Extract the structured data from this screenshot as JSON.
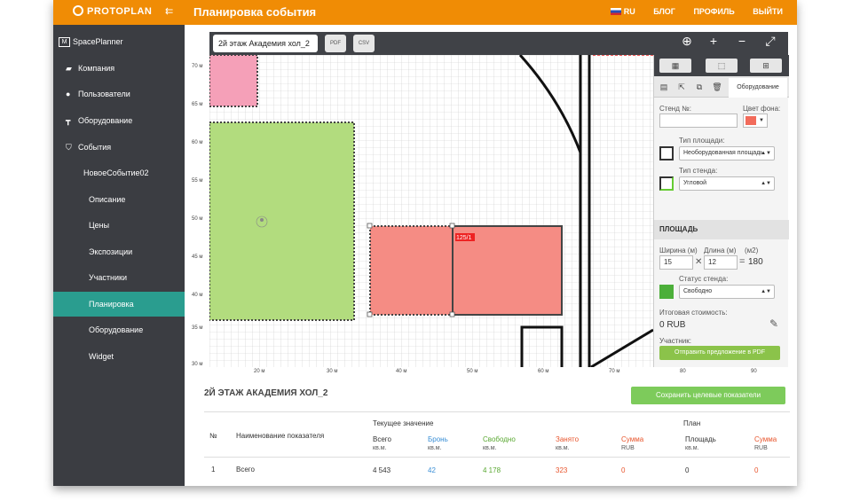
{
  "app": {
    "logo": "PROTOPLAN",
    "collapse_icon": "collapse-icon",
    "page_title": "Планировка события"
  },
  "topnav": {
    "lang": "RU",
    "blog": "БЛОГ",
    "profile": "ПРОФИЛЬ",
    "logout": "ВЫЙТИ"
  },
  "sidebar": {
    "brand": "SpacePlanner",
    "items": [
      {
        "label": "Компания",
        "icon": "briefcase-icon"
      },
      {
        "label": "Пользователи",
        "icon": "user-icon"
      },
      {
        "label": "Оборудование",
        "icon": "table-icon"
      },
      {
        "label": "События",
        "icon": "shield-icon"
      }
    ],
    "event_name": "НовоеСобытие02",
    "sub_items": [
      "Описание",
      "Цены",
      "Экспозиции",
      "Участники",
      "Планировка",
      "Оборудование",
      "Widget"
    ],
    "active": "Планировка"
  },
  "toolbar": {
    "floor_select": "2й этаж Академия хол_2",
    "btn_pdf": "PDF",
    "btn_csv": "CSV"
  },
  "axes": {
    "y_ticks": [
      "70 м",
      "65 м",
      "60 м",
      "55 м",
      "50 м",
      "45 м",
      "40 м",
      "35 м",
      "30 м"
    ],
    "x_ticks": [
      "20 м",
      "30 м",
      "40 м",
      "50 м",
      "60 м",
      "70 м",
      "80 м",
      "90 м"
    ]
  },
  "canvas": {
    "stand_label": "125/1"
  },
  "panel": {
    "tab_equipment": "Оборудование",
    "stand_no_label": "Стенд №:",
    "stand_no_value": "",
    "bg_color_label": "Цвет фона:",
    "bg_color": "#f26b5b",
    "area_type_label": "Тип площади:",
    "area_type_value": "Необорудованная площадь",
    "stand_type_label": "Тип стенда:",
    "stand_type_value": "Угловой",
    "section_title": "ПЛОЩАДЬ",
    "width_label": "Ширина (м)",
    "length_label": "Длина (м)",
    "m2_label": "(м2)",
    "width_value": "15",
    "length_value": "12",
    "times": "✕",
    "equals": "=",
    "area_value": "180",
    "status_label": "Статус стенда:",
    "status_value": "Свободно",
    "status_color": "#4caf3a",
    "cost_label": "Итоговая стоимость:",
    "cost_value": "0 RUB",
    "participant_label": "Участник:",
    "pdf_button": "Отправить предложение в PDF"
  },
  "bottom": {
    "floor_title": "2Й ЭТАЖ АКАДЕМИЯ ХОЛ_2",
    "save_button": "Сохранить целевые показатели",
    "current_header": "Текущее значение",
    "plan_header": "План",
    "col_no": "№",
    "col_name": "Наименование показателя",
    "cols": [
      {
        "label": "Всего",
        "unit": "кв.м.",
        "color": "#333333"
      },
      {
        "label": "Бронь",
        "unit": "кв.м.",
        "color": "#3a8fd6"
      },
      {
        "label": "Свободно",
        "unit": "кв.м.",
        "color": "#5aa832"
      },
      {
        "label": "Занято",
        "unit": "кв.м.",
        "color": "#e8552d"
      },
      {
        "label": "Сумма",
        "unit": "RUB",
        "color": "#e8552d"
      },
      {
        "label": "Площадь",
        "unit": "кв.м.",
        "color": "#333333"
      },
      {
        "label": "Сумма",
        "unit": "RUB",
        "color": "#e8552d"
      }
    ],
    "row": {
      "no": "1",
      "name": "Всего",
      "values": [
        "4 543",
        "42",
        "4 178",
        "323",
        "0",
        "0",
        "0"
      ]
    }
  }
}
